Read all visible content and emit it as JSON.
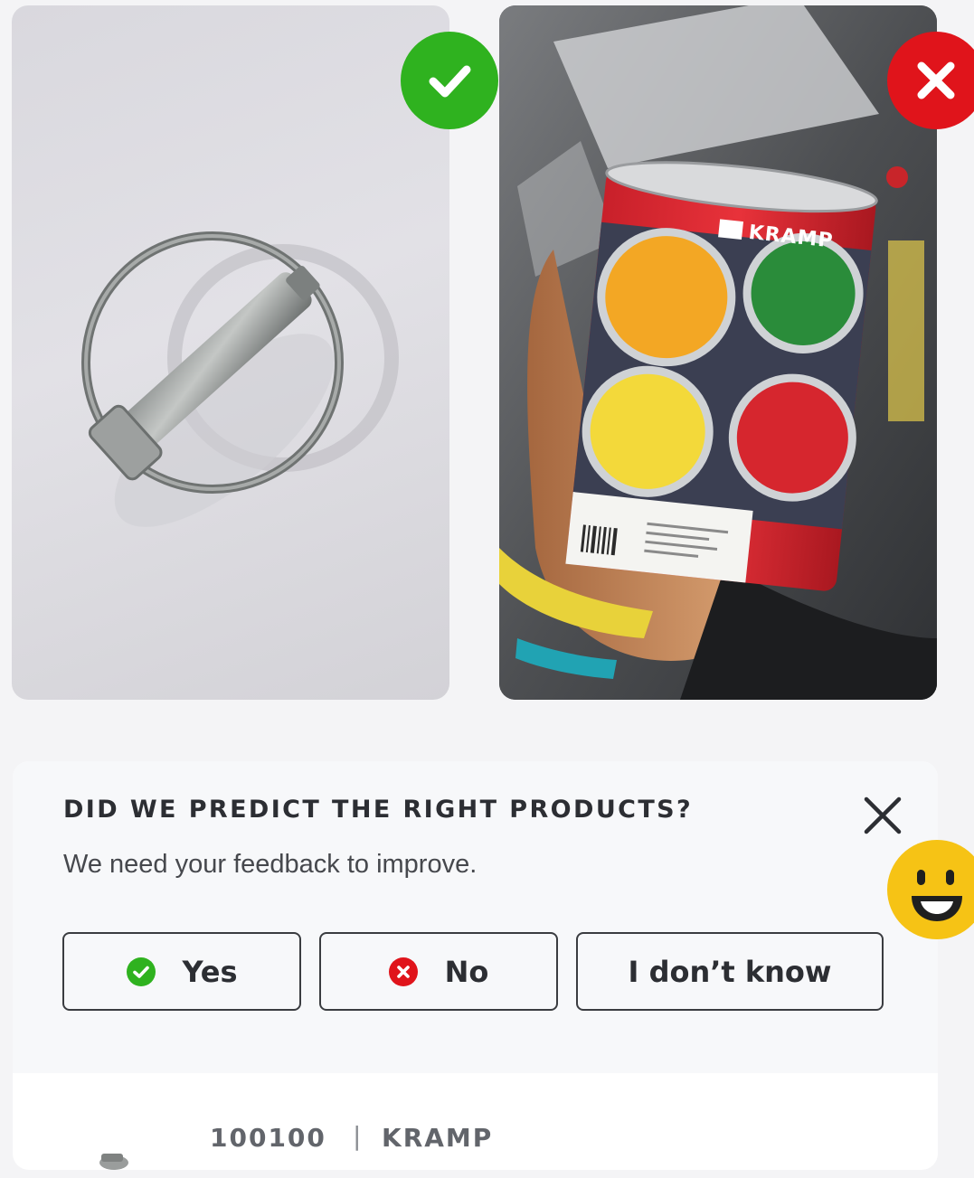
{
  "results": {
    "correct_photo": {
      "subject": "lynch pin with ring",
      "verdict_icon": "check-icon",
      "verdict_color": "#2fb21f"
    },
    "wrong_photo": {
      "subject": "Kramp paint tin held in hand",
      "label_text": "KRAMP",
      "verdict_icon": "close-icon",
      "verdict_color": "#e0141b"
    }
  },
  "feedback": {
    "title": "DID WE PREDICT THE RIGHT PRODUCTS?",
    "subtitle": "We need your feedback to improve.",
    "close_icon": "close-icon",
    "answers": {
      "yes": {
        "label": "Yes",
        "icon": "check-circle-icon",
        "color": "#2fb21f"
      },
      "no": {
        "label": "No",
        "icon": "x-circle-icon",
        "color": "#e0141b"
      },
      "unknown": {
        "label": "I don’t know"
      }
    }
  },
  "product": {
    "code": "100100",
    "separator": "|",
    "brand": "KRAMP"
  },
  "mascot": {
    "icon": "smiley-icon",
    "color": "#f6c315"
  }
}
